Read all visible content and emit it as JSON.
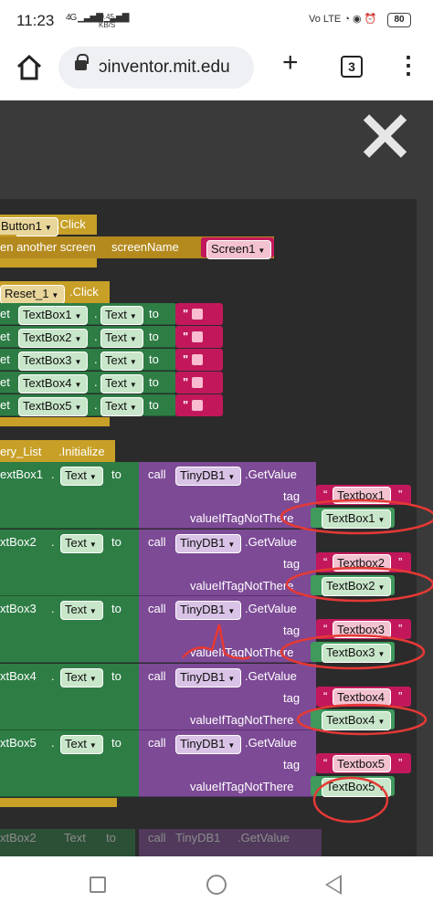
{
  "status_bar": {
    "time": "11:23",
    "signal_text": "4G",
    "rate_value": "0.45",
    "rate_unit": "KB/S",
    "volte": "Vo LTE",
    "battery": "80"
  },
  "browser": {
    "url": "ɔinventor.mit.edu",
    "tab_count": "3"
  },
  "blocks": {
    "ev1": {
      "component": "Button1",
      "event": ".Click"
    },
    "open_screen": {
      "prefix": "en another screen",
      "param": "screenName",
      "value": "Screen1"
    },
    "ev2": {
      "component": "Reset_1",
      "event": ".Click"
    },
    "set_rows": [
      {
        "set": "et",
        "comp": "TextBox1",
        "prop": "Text",
        "to": "to",
        "str": "\" \""
      },
      {
        "set": "et",
        "comp": "TextBox2",
        "prop": "Text",
        "to": "to",
        "str": "\" \""
      },
      {
        "set": "et",
        "comp": "TextBox3",
        "prop": "Text",
        "to": "to",
        "str": "\" \""
      },
      {
        "set": "et",
        "comp": "TextBox4",
        "prop": "Text",
        "to": "to",
        "str": "\" \""
      },
      {
        "set": "et",
        "comp": "TextBox5",
        "prop": "Text",
        "to": "to",
        "str": "\" \""
      }
    ],
    "ev3": {
      "component": "ery_List",
      "event": ".Initialize"
    },
    "get_rows": [
      {
        "comp": "extBox1",
        "prop": "Text",
        "to": "to",
        "call": "call",
        "db": "TinyDB1",
        "method": ".GetValue",
        "tag": "tag",
        "tag_value": "Textbox1",
        "not_there": "valueIfTagNotThere",
        "fallback": "TextBox1"
      },
      {
        "comp": "xtBox2",
        "prop": "Text",
        "to": "to",
        "call": "call",
        "db": "TinyDB1",
        "method": ".GetValue",
        "tag": "tag",
        "tag_value": "Textbox2",
        "not_there": "valueIfTagNotThere",
        "fallback": "TextBox2"
      },
      {
        "comp": "xtBox3",
        "prop": "Text",
        "to": "to",
        "call": "call",
        "db": "TinyDB1",
        "method": ".GetValue",
        "tag": "tag",
        "tag_value": "Textbox3",
        "not_there": "valueIfTagNotThere",
        "fallback": "TextBox3"
      },
      {
        "comp": "xtBox4",
        "prop": "Text",
        "to": "to",
        "call": "call",
        "db": "TinyDB1",
        "method": ".GetValue",
        "tag": "tag",
        "tag_value": "Textbox4",
        "not_there": "valueIfTagNotThere",
        "fallback": "TextBox4"
      },
      {
        "comp": "xtBox5",
        "prop": "Text",
        "to": "to",
        "call": "call",
        "db": "TinyDB1",
        "method": ".GetValue",
        "tag": "tag",
        "tag_value": "Textbox5",
        "not_there": "valueIfTagNotThere",
        "fallback": "TextBox5"
      }
    ],
    "ghost_row": {
      "comp": "xtBox2",
      "prop": "Text",
      "to": "to",
      "call": "call",
      "db": "TinyDB1",
      "method": ".GetValue"
    }
  },
  "colors": {
    "event_block": "#c8a028",
    "setter_block": "#2e7d45",
    "db_block": "#7d4a96",
    "text_block": "#c2185b",
    "annotation": "#e53935"
  }
}
